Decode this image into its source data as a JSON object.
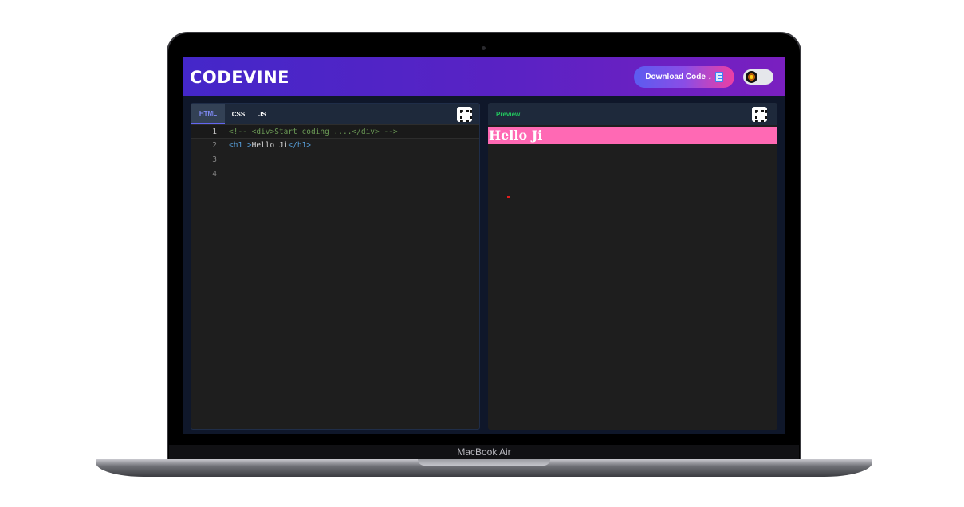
{
  "app": {
    "title": "CODEVINE"
  },
  "header": {
    "download_label": "Download Code ↓",
    "theme_toggle": "light"
  },
  "editor": {
    "tabs": [
      {
        "label": "HTML",
        "active": true
      },
      {
        "label": "CSS",
        "active": false
      },
      {
        "label": "JS",
        "active": false
      }
    ],
    "line_numbers": [
      "1",
      "2",
      "3",
      "4"
    ],
    "lines": {
      "l1_comment": "<!-- <div>Start coding ....</div> -->",
      "l2_open_tag": "<h1 >",
      "l2_text": "Hello Ji",
      "l2_close_tag": "</h1>"
    }
  },
  "preview": {
    "title": "Preview",
    "h1_text": "Hello Ji",
    "h1_background": "#ff69b4"
  },
  "device": {
    "label": "MacBook Air"
  },
  "colors": {
    "header_start": "#4427c9",
    "header_end": "#7a1fc0",
    "accent_tab": "#818cf8",
    "preview_title": "#22c55e"
  }
}
